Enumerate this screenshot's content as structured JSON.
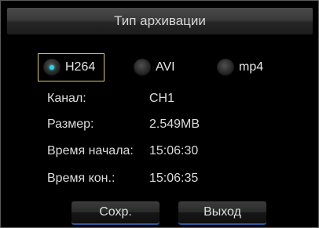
{
  "dialog": {
    "title": "Тип архивации"
  },
  "format": {
    "options": [
      {
        "label": "H264",
        "selected": true
      },
      {
        "label": "AVI",
        "selected": false
      },
      {
        "label": "mp4",
        "selected": false
      }
    ],
    "accent_color": "#26d6e6"
  },
  "info": {
    "channel_label": "Канал:",
    "channel_value": "CH1",
    "size_label": "Размер:",
    "size_value": "2.549MB",
    "start_label": "Время начала:",
    "start_value": "15:06:30",
    "end_label": "Время кон.:",
    "end_value": "15:06:35"
  },
  "buttons": {
    "save_label": "Сохр.",
    "exit_label": "Выход"
  }
}
